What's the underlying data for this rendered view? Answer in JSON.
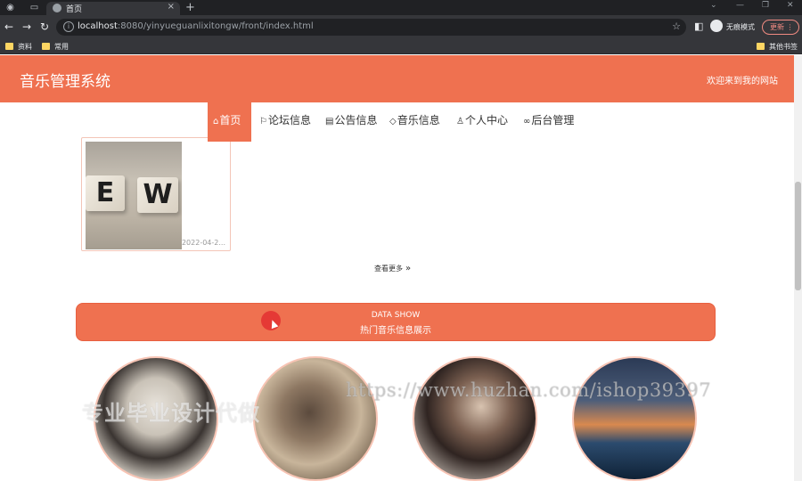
{
  "browser": {
    "tab_title": "首页",
    "url_host": "localhost",
    "url_rest": ":8080/yinyueguanlixitongw/front/index.html",
    "profile_label": "无痕模式",
    "update_label": "更新",
    "bookmarks": [
      "资料",
      "常用"
    ],
    "other_bookmarks": "其他书签"
  },
  "header": {
    "site_title": "音乐管理系统",
    "welcome": "欢迎来到我的网站"
  },
  "nav": [
    {
      "icon": "home-icon",
      "label": "首页",
      "active": true
    },
    {
      "icon": "flag-icon",
      "label": "论坛信息",
      "active": false
    },
    {
      "icon": "notice-icon",
      "label": "公告信息",
      "active": false
    },
    {
      "icon": "tag-icon",
      "label": "音乐信息",
      "active": false
    },
    {
      "icon": "user-icon",
      "label": "个人中心",
      "active": false
    },
    {
      "icon": "link-icon",
      "label": "后台管理",
      "active": false
    }
  ],
  "news_card": {
    "image_letters": [
      "E",
      "W"
    ],
    "date": "2022-04-2..."
  },
  "more_link": "查看更多",
  "data_show": {
    "title": "DATA SHOW",
    "subtitle": "热门音乐信息展示"
  },
  "watermark": {
    "text": "专业毕业设计代做",
    "url": "https://www.huzhan.com/ishop39397"
  },
  "colors": {
    "accent": "#ef7150",
    "browser_dark": "#202124"
  }
}
